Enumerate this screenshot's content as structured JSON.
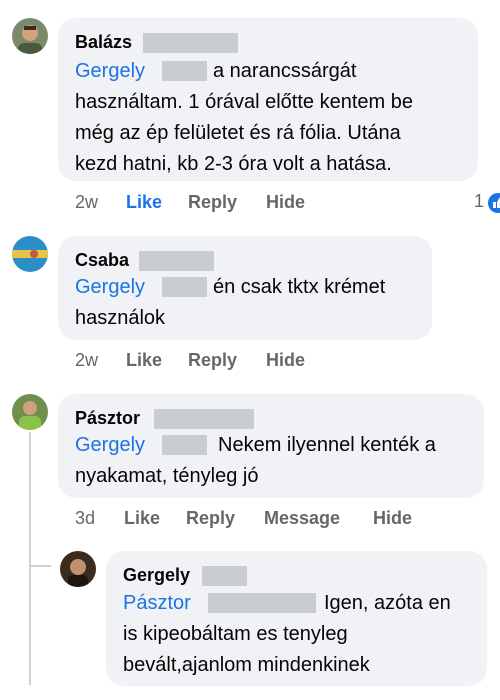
{
  "comments": [
    {
      "author": "Balázs",
      "mention": "Gergely",
      "lines": [
        "a narancssárgát",
        "használtam. 1 órával előtte kentem be",
        "még az ép felületet és rá fólia. Utána",
        "kezd hatni, kb 2-3 óra volt a hatása."
      ],
      "time": "2w",
      "like": "Like",
      "reply": "Reply",
      "hide": "Hide",
      "reaction_count": "1"
    },
    {
      "author": "Csaba",
      "mention": "Gergely",
      "lines": [
        "én csak tktx krémet",
        "használok"
      ],
      "time": "2w",
      "like": "Like",
      "reply": "Reply",
      "hide": "Hide"
    },
    {
      "author": "Pásztor",
      "mention": "Gergely",
      "lines": [
        "Nekem ilyennel kenték a",
        "nyakamat, tényleg jó"
      ],
      "time": "3d",
      "like": "Like",
      "reply": "Reply",
      "message": "Message",
      "hide": "Hide"
    },
    {
      "author": "Gergely",
      "mention": "Pásztor",
      "lines": [
        "Igen, azóta en",
        "is kipeobáltam es tenyleg",
        "bevált,ajanlom mindenkinek"
      ]
    }
  ],
  "colors": {
    "link": "#1b74e4",
    "bubble": "#f0f2f5",
    "meta": "#65676b"
  },
  "icons": {
    "reaction": "like-thumb-icon"
  }
}
